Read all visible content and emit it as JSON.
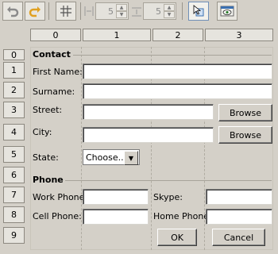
{
  "toolbar": {
    "undo_icon": "undo-arrow-icon",
    "redo_icon": "redo-arrow-icon",
    "grid_icon": "grid-icon",
    "hgap_value": "5",
    "vgap_value": "5",
    "select_icon": "selection-cursor-icon",
    "preview_icon": "preview-eye-icon"
  },
  "columns": [
    "0",
    "1",
    "2",
    "3"
  ],
  "rows": [
    "0",
    "1",
    "2",
    "3",
    "4",
    "5",
    "6",
    "7",
    "8",
    "9"
  ],
  "form": {
    "contact_section": "Contact",
    "first_name_label": "First Name:",
    "surname_label": "Surname:",
    "street_label": "Street:",
    "street_browse": "Browse",
    "city_label": "City:",
    "city_browse": "Browse",
    "state_label": "State:",
    "state_value": "Choose...",
    "phone_section": "Phone",
    "work_phone_label": "Work Phone:",
    "skype_label": "Skype:",
    "cell_phone_label": "Cell Phone:",
    "home_phone_label": "Home Phone:",
    "ok_label": "OK",
    "cancel_label": "Cancel"
  }
}
